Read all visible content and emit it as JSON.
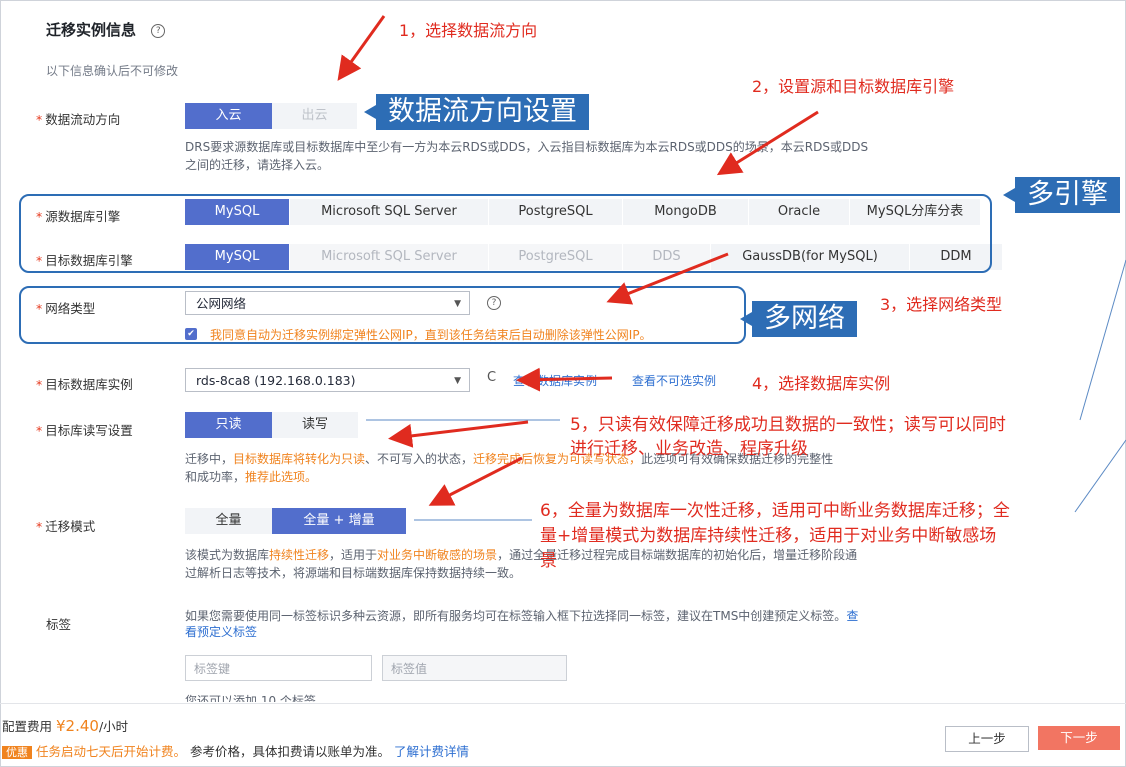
{
  "section": {
    "title": "迁移实例信息",
    "help": "?",
    "hint": "以下信息确认后不可修改"
  },
  "flow": {
    "label": "数据流动方向",
    "options": [
      "入云",
      "出云"
    ],
    "desc1": "DRS要求源数据库或目标数据库中至少有一方为本云RDS或DDS，入云指目标数据库为本云RDS或DDS的场景，本云RDS或DDS",
    "desc2": "之间的迁移，请选择入云。"
  },
  "source_engine": {
    "label": "源数据库引擎",
    "options": [
      "MySQL",
      "Microsoft SQL Server",
      "PostgreSQL",
      "MongoDB",
      "Oracle",
      "MySQL分库分表"
    ]
  },
  "target_engine": {
    "label": "目标数据库引擎",
    "options": [
      "MySQL",
      "Microsoft SQL Server",
      "PostgreSQL",
      "DDS",
      "GaussDB(for MySQL)",
      "DDM"
    ]
  },
  "network": {
    "label": "网络类型",
    "value": "公网网络",
    "help": "?",
    "checkbox_text": "我同意自动为迁移实例绑定弹性公网IP，直到该任务结束后自动删除该弹性公网IP。"
  },
  "target_instance": {
    "label": "目标数据库实例",
    "value": "rds-8ca8 (192.168.0.183)",
    "refresh": "C",
    "link1": "查看数据库实例",
    "link2": "查看不可选实例"
  },
  "rw": {
    "label": "目标库读写设置",
    "options": [
      "只读",
      "读写"
    ],
    "desc1_a": "迁移中，",
    "desc1_b": "目标数据库将转化为只读",
    "desc1_c": "、不可写入的状态，",
    "desc1_d": "迁移完成后恢复为可读写状态，",
    "desc1_e": "此选项可有效确保数据迁移的完整性",
    "desc2_a": "和成功率，",
    "desc2_b": "推荐此选项。"
  },
  "mode": {
    "label": "迁移模式",
    "options": [
      "全量",
      "全量 + 增量"
    ],
    "desc1_a": "该模式为数据库",
    "desc1_b": "持续性迁移",
    "desc1_c": "，适用于",
    "desc1_d": "对业务中断敏感的场景",
    "desc1_e": "，通过全量迁移过程完成目标端数据库的初始化后，增量迁移阶段通",
    "desc2": "过解析日志等技术，将源端和目标端数据库保持数据持续一致。"
  },
  "tags": {
    "label": "标签",
    "desc1": "如果您需要使用同一标签标识多种云资源，即所有服务均可在标签输入框下拉选择同一标签，建议在TMS中创建预定义标签。",
    "link_a": "查",
    "link_b": "看预定义标签",
    "key_placeholder": "标签键",
    "value_placeholder": "标签值",
    "more": "您还可以添加 10 个标签。"
  },
  "footer": {
    "cost_label": "配置费用",
    "cost_value": "¥2.40",
    "cost_unit": "/小时",
    "badge": "优惠",
    "promo": "任务启动七天后开始计费。",
    "note": "参考价格，具体扣费请以账单为准。",
    "link": "了解计费详情",
    "prev": "上一步",
    "next": "下一步"
  },
  "annotations": {
    "a1": "1，选择数据流方向",
    "a2": "2，设置源和目标数据库引擎",
    "a3": "3，选择网络类型",
    "a4": "4，选择数据库实例",
    "a5_1": "5，只读有效保障迁移成功且数据的一致性；读写可以同时",
    "a5_2": "进行迁移、业务改造、程序升级",
    "a6_1": "6，全量为数据库一次性迁移，适用可中断业务数据库迁移；全",
    "a6_2": "量+增量模式为数据库持续性迁移，适用于对业务中断敏感场",
    "a6_3": "景",
    "callout_flow": "数据流方向设置",
    "callout_engine": "多引擎",
    "callout_network": "多网络"
  },
  "colors": {
    "primary": "#526ecc",
    "annotation": "#e02b1f",
    "callout": "#2d6db5",
    "orange": "#f0831e"
  }
}
